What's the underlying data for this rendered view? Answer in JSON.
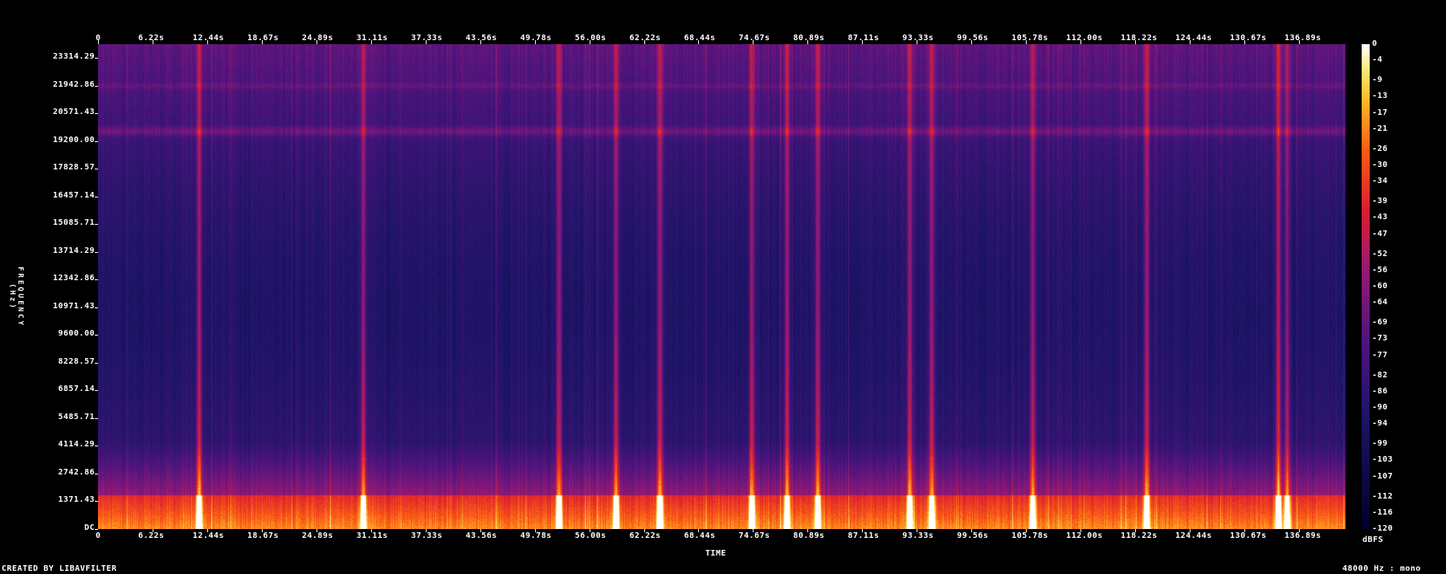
{
  "chart_data": {
    "type": "heatmap",
    "title": "",
    "xlabel": "TIME",
    "ylabel": "FREQUENCY (Hz)",
    "x_ticks": [
      "0",
      "6.22s",
      "12.44s",
      "18.67s",
      "24.89s",
      "31.11s",
      "37.33s",
      "43.56s",
      "49.78s",
      "56.00s",
      "62.22s",
      "68.44s",
      "74.67s",
      "80.89s",
      "87.11s",
      "93.33s",
      "99.56s",
      "105.78s",
      "112.00s",
      "118.22s",
      "124.44s",
      "130.67s",
      "136.89s"
    ],
    "x_ticks_bottom": [
      "6.22s",
      "12.44s",
      "18.67s",
      "24.89s",
      "31.11s",
      "37.33s",
      "43.56s",
      "49.78s",
      "56.00s",
      "62.22s",
      "68.44s",
      "74.67s",
      "80.89s",
      "87.11s",
      "93.33s",
      "99.56s",
      "105.78s",
      "112.00s",
      "118.22s",
      "124.44s",
      "130.67s",
      "136.89s"
    ],
    "x_tick_bottom_zero": "0",
    "x_range_s": [
      0,
      142.2
    ],
    "y_ticks": [
      "23314.29",
      "21942.86",
      "20571.43",
      "19200.00",
      "17828.57",
      "16457.14",
      "15085.71",
      "13714.29",
      "12342.86",
      "10971.43",
      "9600.00",
      "8228.57",
      "6857.14",
      "5485.71",
      "4114.29",
      "2742.86",
      "1371.43",
      "DC"
    ],
    "y_range_hz": [
      0,
      24000
    ],
    "colorbar_label": "dBFS",
    "colorbar_ticks": [
      "0",
      "-4",
      "-9",
      "-13",
      "-17",
      "-21",
      "-26",
      "-30",
      "-34",
      "-39",
      "-43",
      "-47",
      "-52",
      "-56",
      "-60",
      "-64",
      "-69",
      "-73",
      "-77",
      "-82",
      "-86",
      "-90",
      "-94",
      "-99",
      "-103",
      "-107",
      "-112",
      "-116",
      "-120"
    ],
    "colorbar_range_dbfs": [
      -120,
      0
    ],
    "bright_band_times_s": [
      11.5,
      30.2,
      52.5,
      59.0,
      64.0,
      74.5,
      78.5,
      82.0,
      92.5,
      95.0,
      106.5,
      119.5,
      134.5,
      135.5
    ],
    "bright_band_hz": [
      19700,
      21950
    ]
  },
  "footer": {
    "credit": "CREATED BY LIBAVFILTER",
    "format": "48000 Hz : mono"
  },
  "colors": {
    "background": "#000000",
    "text": "#ffffff"
  }
}
